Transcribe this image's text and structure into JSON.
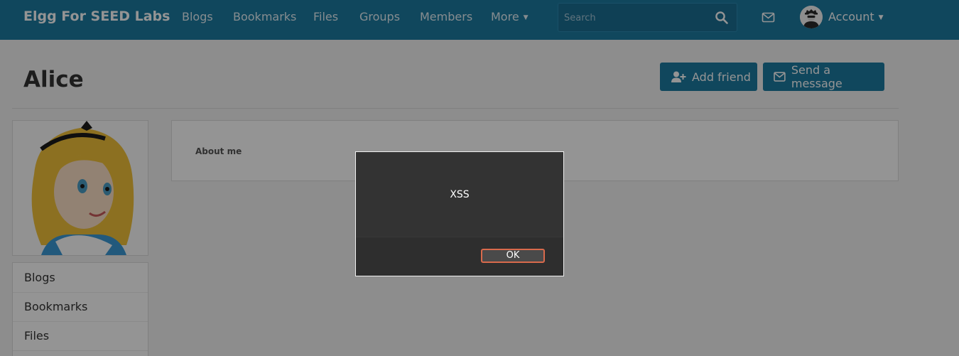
{
  "header": {
    "site_name": "Elgg For SEED Labs",
    "nav": [
      "Blogs",
      "Bookmarks",
      "Files",
      "Groups",
      "Members"
    ],
    "more_label": "More",
    "search_placeholder": "Search",
    "account_label": "Account",
    "icons": [
      "search-icon",
      "mail-icon",
      "user-avatar"
    ]
  },
  "profile": {
    "name": "Alice",
    "actions": {
      "add_friend": "Add friend",
      "send_message": "Send a message"
    },
    "about_label": "About me",
    "menu": [
      "Blogs",
      "Bookmarks",
      "Files"
    ]
  },
  "dialog": {
    "message": "XSS",
    "ok_label": "OK"
  },
  "colors": {
    "header_bg": "#1d7aa1",
    "button_bg": "#1d7aa1",
    "dialog_bg": "#333333",
    "ok_border": "#d96a4c"
  }
}
